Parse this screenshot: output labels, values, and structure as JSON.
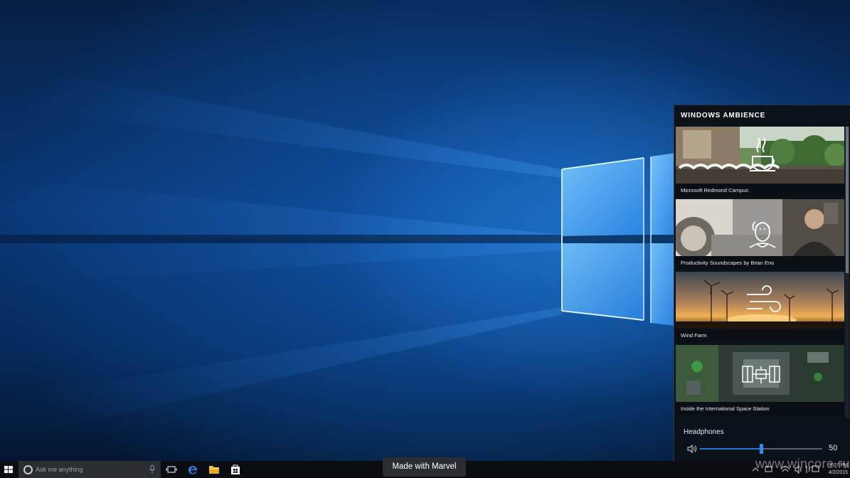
{
  "panel": {
    "title": "WINDOWS AMBIENCE",
    "cards": [
      {
        "label": "Microsoft Redmond Campus",
        "icon": "coffee-cup-icon"
      },
      {
        "label": "Productivity Soundscapes by Brian Eno",
        "icon": "portrait-icon"
      },
      {
        "label": "Wind Farm",
        "icon": "wind-icon"
      },
      {
        "label": "Inside the International Space Station",
        "icon": "satellite-icon"
      }
    ],
    "audio_device": "Headphones",
    "volume": "50",
    "volume_level": 0.5
  },
  "taskbar": {
    "search_placeholder": "Ask me anything",
    "clock_time": "3:07 PM",
    "clock_date": "4/2/2015",
    "icons": [
      "windows-start-icon",
      "cortana-icon",
      "microphone-icon",
      "task-view-icon",
      "edge-icon",
      "file-explorer-icon",
      "store-icon"
    ]
  },
  "overlay": {
    "marvel_badge": "Made with Marvel",
    "watermark": "www.wincore.ru"
  },
  "colors": {
    "accent": "#1f7ae0",
    "panel_bg": "#0c121a",
    "taskbar_bg": "#0a0d12",
    "wallpaper_blue": "#0a3775"
  }
}
